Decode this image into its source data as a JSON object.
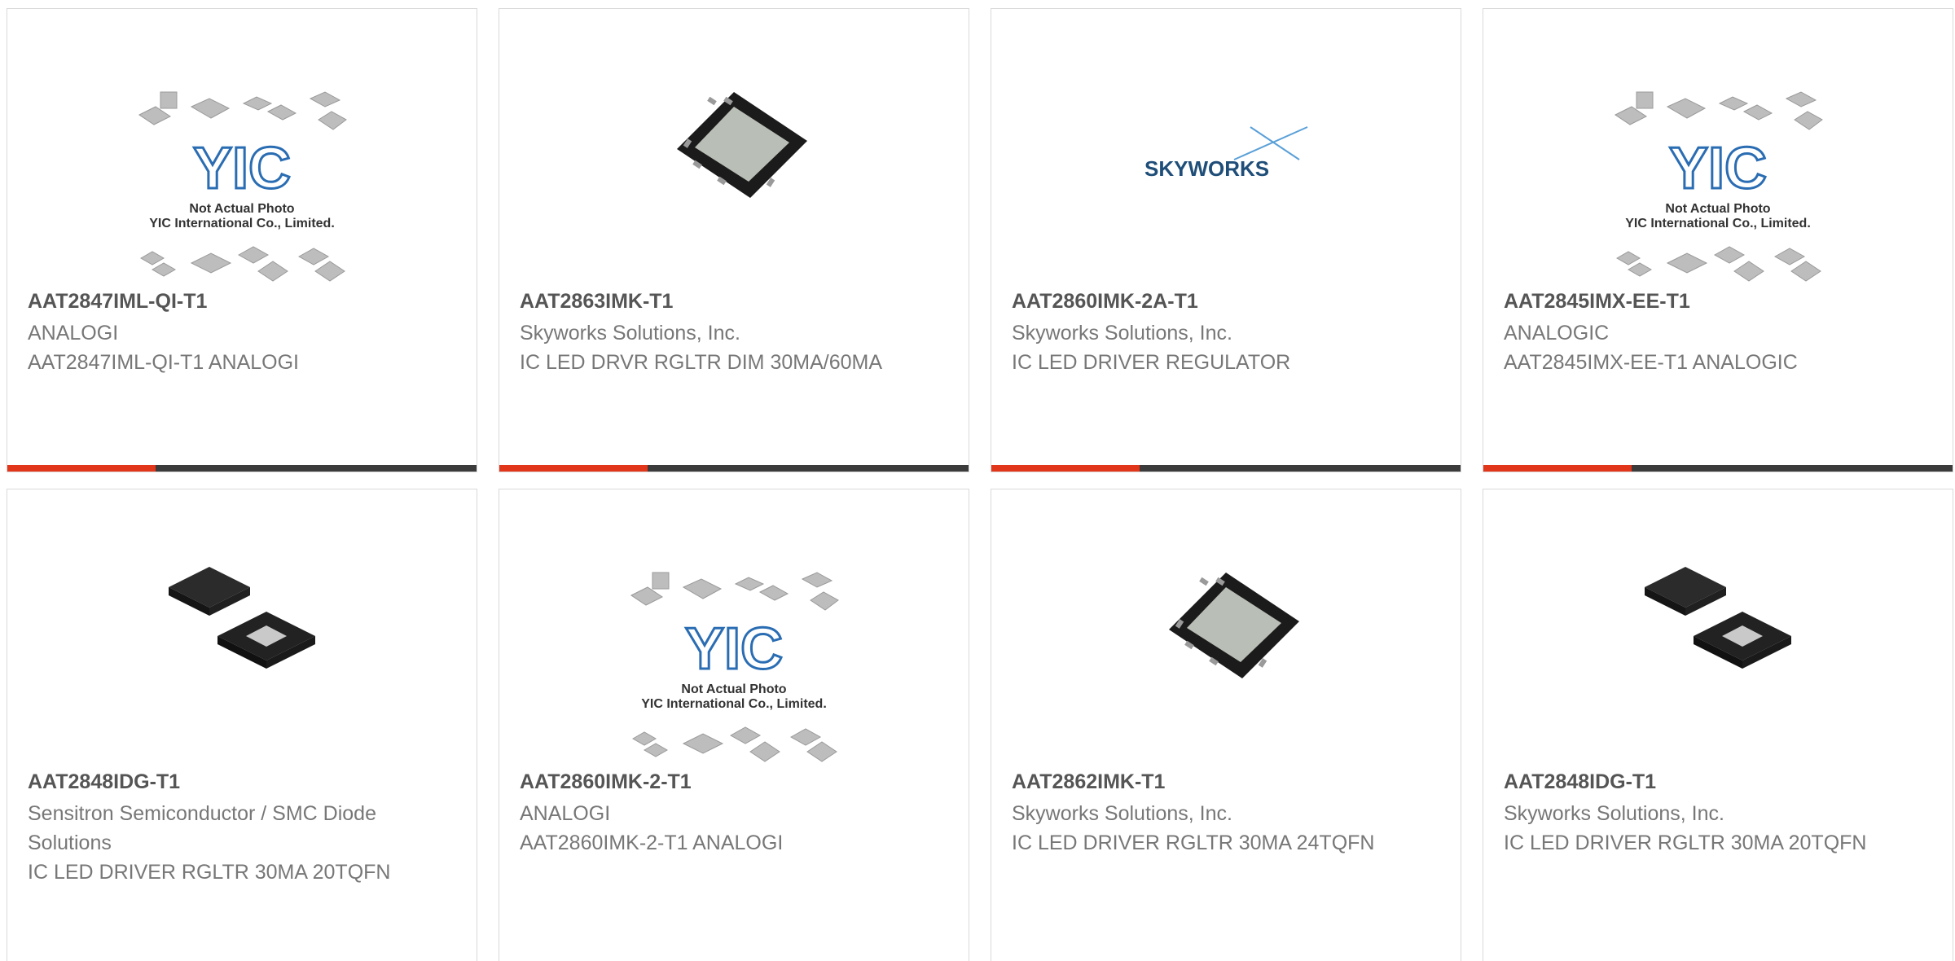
{
  "colors": {
    "accent": "#e2361a",
    "bar": "#3b3b3b",
    "skyworks": "#1f4e79",
    "yic": "#2a6db3"
  },
  "image_text": {
    "yic_logo": "YIC",
    "yic_note_1": "Not Actual Photo",
    "yic_note_2": "YIC International Co., Limited.",
    "skyworks_logo": "SKYWORKS"
  },
  "products": [
    {
      "part": "AAT2847IML-QI-T1",
      "manufacturer": "ANALOGI",
      "description": "AAT2847IML-QI-T1 ANALOGI",
      "image": "yic-placeholder"
    },
    {
      "part": "AAT2863IMK-T1",
      "manufacturer": "Skyworks Solutions, Inc.",
      "description": "IC LED DRVR RGLTR DIM 30MA/60MA",
      "image": "qfn-chip"
    },
    {
      "part": "AAT2860IMK-2A-T1",
      "manufacturer": "Skyworks Solutions, Inc.",
      "description": "IC LED DRIVER REGULATOR",
      "image": "skyworks-logo"
    },
    {
      "part": "AAT2845IMX-EE-T1",
      "manufacturer": "ANALOGIC",
      "description": "AAT2845IMX-EE-T1 ANALOGIC",
      "image": "yic-placeholder"
    },
    {
      "part": "AAT2848IDG-T1",
      "manufacturer": "Sensitron Semiconductor / SMC Diode Solutions",
      "description": "IC LED DRIVER RGLTR 30MA 20TQFN",
      "image": "tqfn-pair"
    },
    {
      "part": "AAT2860IMK-2-T1",
      "manufacturer": "ANALOGI",
      "description": "AAT2860IMK-2-T1 ANALOGI",
      "image": "yic-placeholder"
    },
    {
      "part": "AAT2862IMK-T1",
      "manufacturer": "Skyworks Solutions, Inc.",
      "description": "IC LED DRIVER RGLTR 30MA 24TQFN",
      "image": "qfn-chip"
    },
    {
      "part": "AAT2848IDG-T1",
      "manufacturer": "Skyworks Solutions, Inc.",
      "description": "IC LED DRIVER RGLTR 30MA 20TQFN",
      "image": "tqfn-pair"
    }
  ]
}
